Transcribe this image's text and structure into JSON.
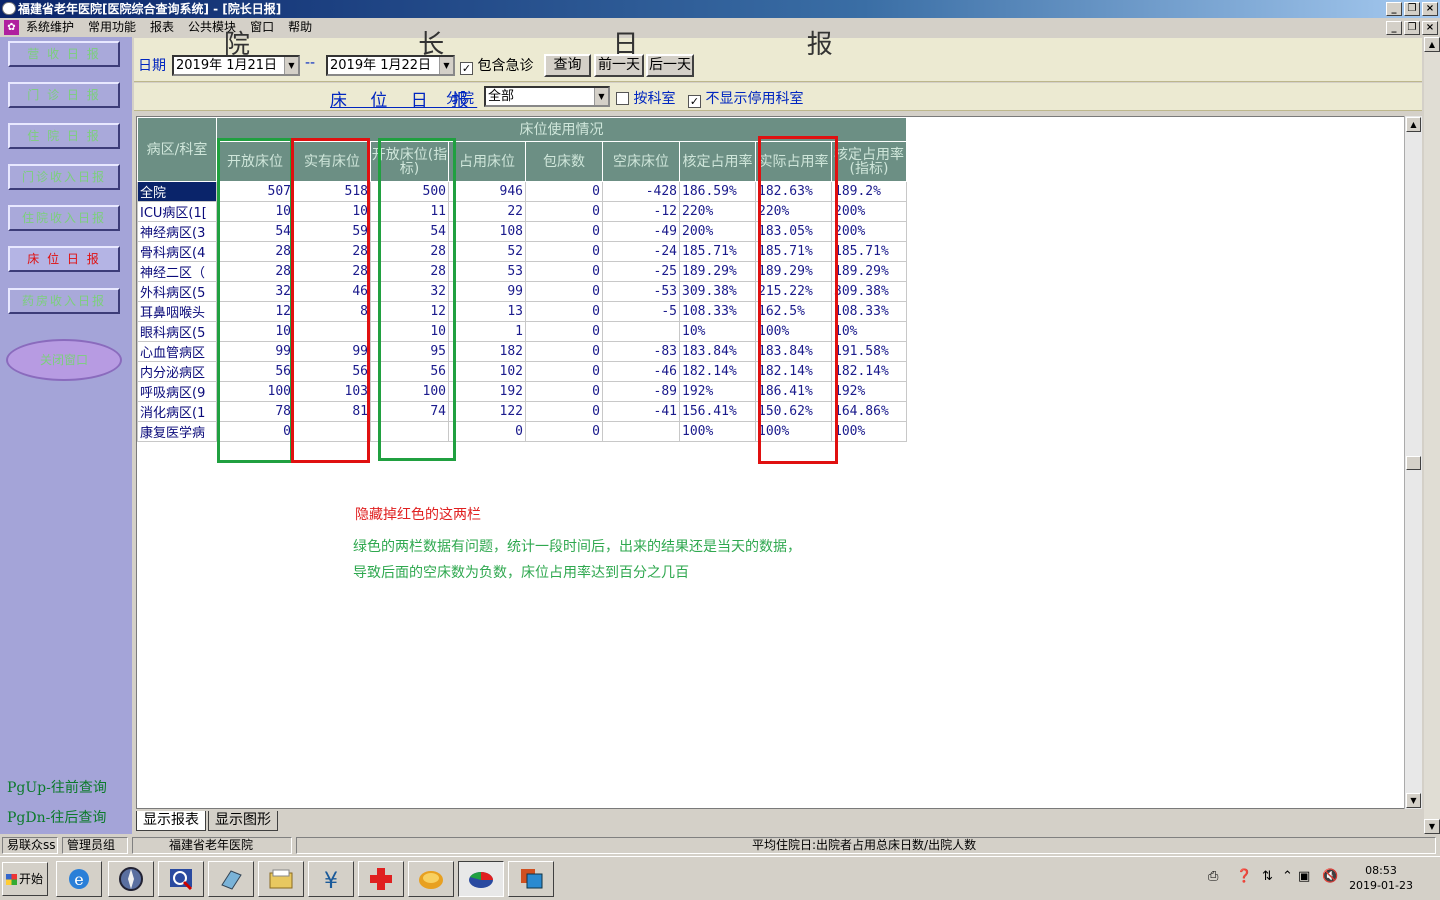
{
  "window": {
    "title": "福建省老年医院[医院综合查询系统] - [院长日报]"
  },
  "menu": [
    "系统维护",
    "常用功能",
    "报表",
    "公共模块",
    "窗口",
    "帮助"
  ],
  "sidebar": {
    "items": [
      {
        "label": "营 收 日 报"
      },
      {
        "label": "门 诊 日 报"
      },
      {
        "label": "住 院 日 报"
      },
      {
        "label": "门诊收入日报"
      },
      {
        "label": "住院收入日报"
      },
      {
        "label": "床 位 日 报"
      },
      {
        "label": "药房收入日报"
      }
    ],
    "oval_button": "关闭窗口",
    "pgup": "PgUp-往前查询",
    "pgdn": "PgDn-往后查询"
  },
  "toolbar": {
    "big_title": "院 长 日 报",
    "date_label": "日期",
    "date_from": "2019年  1月21日",
    "date_sep": "--",
    "date_to": "2019年  1月22日",
    "include_emergency": "包含急诊",
    "query": "查询",
    "prev_day": "前一天",
    "next_day": "后一天"
  },
  "filter": {
    "report_title": "床 位 日 报",
    "branch_label": "分院",
    "branch_value": "全部",
    "by_dept": "按科室",
    "hide_disabled": "不显示停用科室"
  },
  "table": {
    "group_header": "床位使用情况",
    "row_header": "病区/科室",
    "columns": [
      "开放床位",
      "实有床位",
      "开放床位(指标)",
      "占用床位",
      "包床数",
      "空床床位",
      "核定占用率",
      "实际占用率",
      "核定占用率(指标)"
    ],
    "rows": [
      [
        "全院",
        "507",
        "518",
        "500",
        "946",
        "0",
        "-428",
        "186.59%",
        "182.63%",
        "189.2%"
      ],
      [
        "ICU病区(1[",
        "10",
        "10",
        "11",
        "22",
        "0",
        "-12",
        "220%",
        "220%",
        "200%"
      ],
      [
        "神经病区(3",
        "54",
        "59",
        "54",
        "108",
        "0",
        "-49",
        "200%",
        "183.05%",
        "200%"
      ],
      [
        "骨科病区(4",
        "28",
        "28",
        "28",
        "52",
        "0",
        "-24",
        "185.71%",
        "185.71%",
        "185.71%"
      ],
      [
        "神经二区（",
        "28",
        "28",
        "28",
        "53",
        "0",
        "-25",
        "189.29%",
        "189.29%",
        "189.29%"
      ],
      [
        "外科病区(5",
        "32",
        "46",
        "32",
        "99",
        "0",
        "-53",
        "309.38%",
        "215.22%",
        "309.38%"
      ],
      [
        "耳鼻咽喉头",
        "12",
        "8",
        "12",
        "13",
        "0",
        "-5",
        "108.33%",
        "162.5%",
        "108.33%"
      ],
      [
        "眼科病区(5",
        "10",
        "",
        "10",
        "1",
        "0",
        "",
        "10%",
        "100%",
        "10%"
      ],
      [
        "心血管病区",
        "99",
        "99",
        "95",
        "182",
        "0",
        "-83",
        "183.84%",
        "183.84%",
        "191.58%"
      ],
      [
        "内分泌病区",
        "56",
        "56",
        "56",
        "102",
        "0",
        "-46",
        "182.14%",
        "182.14%",
        "182.14%"
      ],
      [
        "呼吸病区(9",
        "100",
        "103",
        "100",
        "192",
        "0",
        "-89",
        "192%",
        "186.41%",
        "192%"
      ],
      [
        "消化病区(1",
        "78",
        "81",
        "74",
        "122",
        "0",
        "-41",
        "156.41%",
        "150.62%",
        "164.86%"
      ],
      [
        "康复医学病",
        "0",
        "",
        "",
        "0",
        "0",
        "",
        "100%",
        "100%",
        "100%"
      ]
    ]
  },
  "notes": {
    "red": "隐藏掉红色的这两栏",
    "green1": "绿色的两栏数据有问题，统计一段时间后，出来的结果还是当天的数据，",
    "green2": "导致后面的空床数为负数，床位占用率达到百分之几百"
  },
  "tabs": [
    "显示报表",
    "显示图形"
  ],
  "status": {
    "app": "易联众ss",
    "group": "管理员组",
    "hospital": "福建省老年医院",
    "hint": "平均住院日:出院者占用总床日数/出院人数"
  },
  "taskbar": {
    "start": "开始",
    "time": "08:53",
    "date": "2019-01-23"
  },
  "colors": {
    "red_box": "#e01010",
    "green_box": "#20a040",
    "header_bg": "#6c8f84",
    "sidebar_bg": "#a4a4d8",
    "note_red": "#e02020",
    "note_green": "#2fa84f"
  }
}
